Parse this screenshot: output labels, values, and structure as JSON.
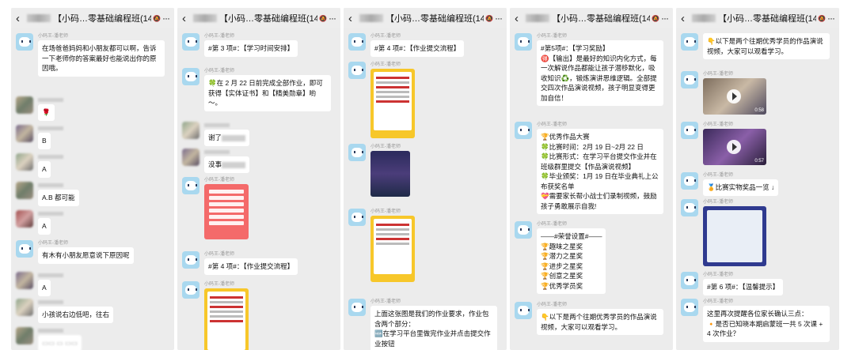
{
  "header": {
    "back_icon": "chevron-left-icon",
    "title": "【小码…零基础编程班(143)",
    "mute_icon": "mute-icon",
    "more_label": "···"
  },
  "sender_name": "小码王-潘老师",
  "panels": [
    {
      "messages": [
        {
          "text": "在场爸爸妈妈和小朋友都可以啊，告诉一下老师你的答案最好也能说出你的原因哦。"
        },
        {
          "text": "🌹"
        },
        {
          "text": "B"
        },
        {
          "text": "A"
        },
        {
          "text": "A.B 都可能"
        },
        {
          "text": "A"
        },
        {
          "text": "有木有小朋友愿意说下原因呢"
        },
        {
          "text": "A"
        },
        {
          "text": "小孩说右边低吧，往右"
        },
        {
          "text": "▭▭ ▭ ▭▭"
        }
      ]
    },
    {
      "messages": [
        {
          "text": "#第 3 项#：【学习时间安排】"
        },
        {
          "text": "🍀在 2 月 22 日前完成全部作业，即可获得【实体证书】和【精美勋章】哟～。"
        },
        {
          "text": "谢了"
        },
        {
          "text": "没事"
        },
        {
          "text": "#第 4 项#：【作业提交流程】"
        }
      ]
    },
    {
      "messages": [
        {
          "text": "#第 4 项#：【作业提交流程】"
        },
        {
          "text": "上面这张图是我们的作业要求，作业包含两个部分："
        },
        {
          "text": "🆕在学习平台里做完作业并点击提交作业按钮"
        }
      ]
    },
    {
      "messages": [
        {
          "text": "#第5项#：【学习奖励】"
        },
        {
          "text": "🉐【输出】是最好的知识内化方式，每一次解说作品都能让孩子潜移默化，吸收知识♻️，锻炼演讲思维逻辑。全部提交四次作品演说视频，孩子明显变得更加自信！"
        },
        {
          "text": "🏆优秀作品大赛"
        },
        {
          "text": "🍀比赛时间：2月 19 日~2月 22 日"
        },
        {
          "text": "🍀比赛形式：在学习平台提交作业并在班级群里提交【作品演说视频】"
        },
        {
          "text": "🍀毕业颁奖：1月 19 日在毕业典礼上公布获奖名单"
        },
        {
          "text": "💝需要家长帮小战士们录制视频，鼓励孩子勇敢展示自我!"
        },
        {
          "text": "——#荣誉设置#——"
        },
        {
          "text": "🏆趣味之星奖"
        },
        {
          "text": "🏆潜力之星奖"
        },
        {
          "text": "🏆进步之星奖"
        },
        {
          "text": "🏆创意之星奖"
        },
        {
          "text": "🏆优秀学员奖"
        },
        {
          "text": "👇以下是两个往期优秀学员的作品演说视频，大家可以观看学习。"
        }
      ]
    },
    {
      "messages": [
        {
          "text": "👇以下是两个往期优秀学员的作品演说视频，大家可以观看学习。"
        },
        {
          "text": "0:58"
        },
        {
          "text": "0:57"
        },
        {
          "text": "🏅比赛实物奖品一览 ↓"
        },
        {
          "text": "#第 6 项#：【温馨提示】"
        },
        {
          "text": "这里再次提醒各位家长确认三点："
        },
        {
          "text": "🔸是否已知晓本期启蒙班一共 5 次课 +4 次作业？"
        }
      ]
    }
  ]
}
